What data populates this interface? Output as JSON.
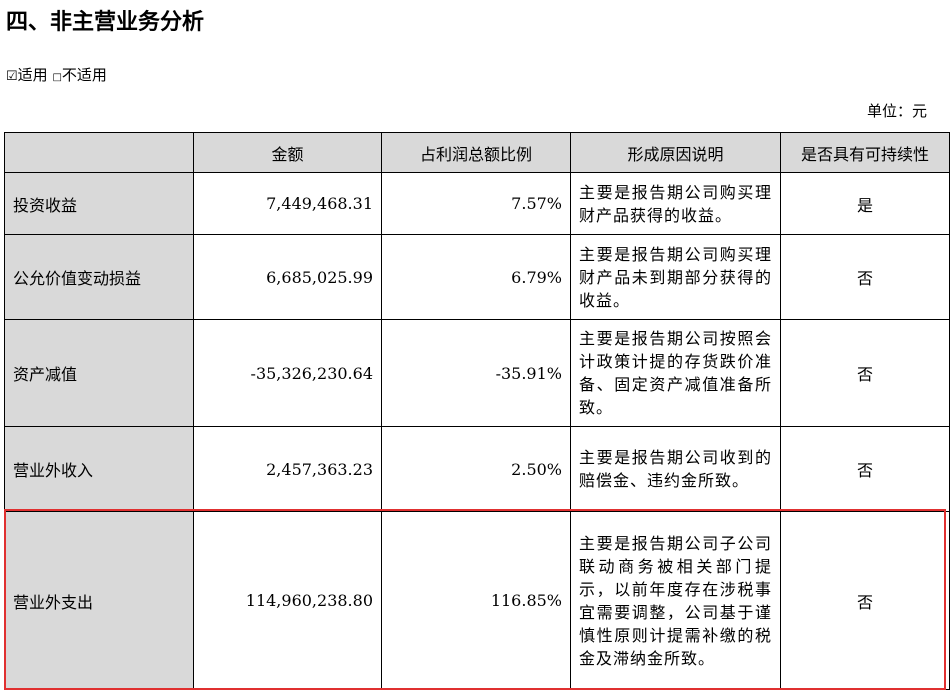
{
  "section_title": "四、非主营业务分析",
  "applicability": {
    "applicable_box": "☑",
    "applicable_label": "适用",
    "not_applicable_box": "□",
    "not_applicable_label": "不适用"
  },
  "unit_label": "单位：元",
  "table": {
    "headers": [
      "",
      "金额",
      "占利润总额比例",
      "形成原因说明",
      "是否具有可持续性"
    ],
    "rows": [
      {
        "item": "投资收益",
        "amount": "7,449,468.31",
        "ratio": "7.57%",
        "reason": "主要是报告期公司购买理财产品获得的收益。",
        "sustainable": "是"
      },
      {
        "item": "公允价值变动损益",
        "amount": "6,685,025.99",
        "ratio": "6.79%",
        "reason": "主要是报告期公司购买理财产品未到期部分获得的收益。",
        "sustainable": "否"
      },
      {
        "item": "资产减值",
        "amount": "-35,326,230.64",
        "ratio": "-35.91%",
        "reason": "主要是报告期公司按照会计政策计提的存货跌价准备、固定资产减值准备所致。",
        "sustainable": "否"
      },
      {
        "item": "营业外收入",
        "amount": "2,457,363.23",
        "ratio": "2.50%",
        "reason": "主要是报告期公司收到的赔偿金、违约金所致。",
        "sustainable": "否"
      },
      {
        "item": "营业外支出",
        "amount": "114,960,238.80",
        "ratio": "116.85%",
        "reason": "主要是报告期公司子公司联动商务被相关部门提示，以前年度存在涉税事宜需要调整，公司基于谨慎性原则计提需补缴的税金及滞纳金所致。",
        "sustainable": "否"
      }
    ]
  },
  "highlight_color": "#e03030"
}
